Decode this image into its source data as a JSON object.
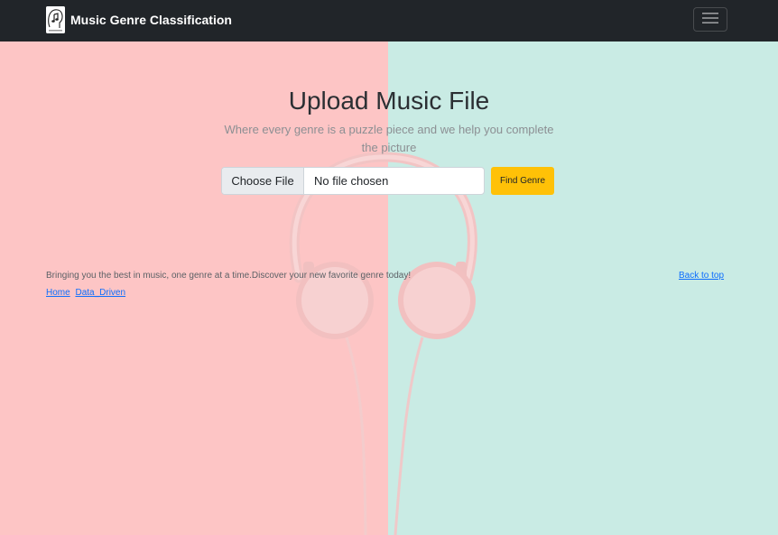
{
  "navbar": {
    "brand_title": "Music Genre Classification",
    "logo_icon": "music-note-head-icon",
    "menu_icon": "hamburger-menu-icon",
    "background_color": "#212529"
  },
  "hero": {
    "title": "Upload Music File",
    "subtitle": "Where every genre is a puzzle piece and we help you complete the picture",
    "background_left_color": "#fdc5c5",
    "background_right_color": "#c9ebe4"
  },
  "upload": {
    "choose_button_label": "Choose File",
    "file_status": "No file chosen",
    "submit_label": "Find Genre",
    "submit_color": "#ffc107"
  },
  "footer": {
    "tagline": "Bringing you the best in music, one genre at a time.Discover your new favorite genre today!",
    "back_to_top": "Back to top",
    "links": [
      "Home",
      "Data_Driven"
    ],
    "link_color": "#0d6efd"
  }
}
